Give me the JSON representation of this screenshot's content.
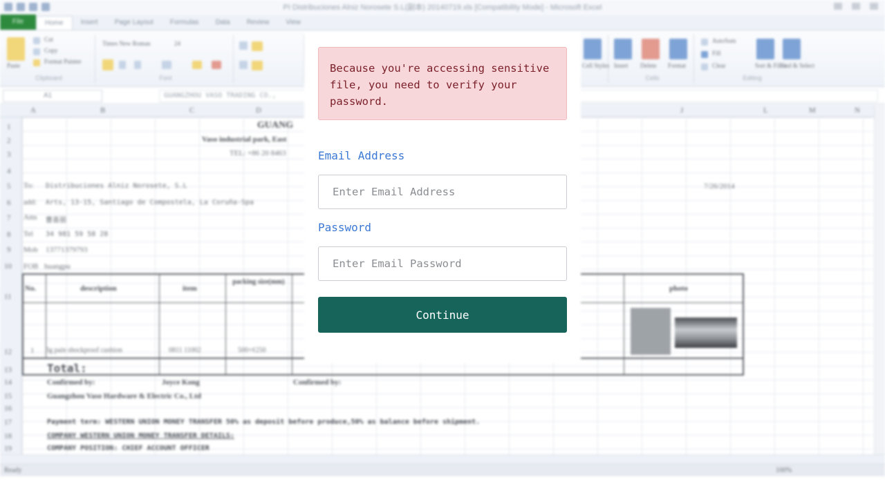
{
  "background": {
    "window_title": "PI Distribuciones Alniz Norosete S.L(副本) 20140719.xls [Compatibility Mode] - Microsoft Excel",
    "tabs": [
      "File",
      "Home",
      "Insert",
      "Page Layout",
      "Formulas",
      "Data",
      "Review",
      "View"
    ],
    "ribbon": {
      "clipboard": {
        "paste": "Paste",
        "cut": "Cut",
        "copy": "Copy",
        "format_painter": "Format Painter",
        "caption": "Clipboard"
      },
      "font": {
        "font_name": "Times New Roman",
        "font_size": "24",
        "caption": "Font"
      },
      "styles": {
        "cell_styles": "Cell Styles"
      },
      "cells": {
        "insert": "Insert",
        "delete": "Delete",
        "format": "Format",
        "caption": "Cells"
      },
      "editing": {
        "autosum": "AutoSum",
        "fill": "Fill",
        "clear": "Clear",
        "sort": "Sort & Filter",
        "find": "Find & Select",
        "caption": "Editing"
      }
    },
    "name_box": "A1",
    "formula": "GUANGZHOU VASO TRADING CO.,",
    "columns": [
      "A",
      "B",
      "C",
      "D",
      "J",
      "L",
      "M",
      "N"
    ],
    "rows": [
      "1",
      "2",
      "3",
      "4",
      "5",
      "6",
      "7",
      "8",
      "9",
      "10",
      "11",
      "12",
      "13",
      "14",
      "15",
      "16",
      "17",
      "18",
      "19"
    ],
    "sheet": {
      "company": "GUANG",
      "address": "Vaso industrial park, East",
      "tel": "TEL: +86 20 8463",
      "to_label": "To:",
      "to_value": "Distribuciones Alniz Norosete, S.L",
      "addr_label": "add:",
      "addr_value": "Arts, 13-15, Santiago de Compostela, La Coruña-Spa",
      "attn_label": "Attn",
      "attn_value": "曹喜丽",
      "tel_label": "Tel",
      "tel_value": "34 981 59 58 28",
      "mob_label": "Mob",
      "mob_value": "13771379793",
      "fob_label": "FOB",
      "fob_value": "huangpu",
      "date": "7/26/2014",
      "headers": {
        "no": "No.",
        "description": "description",
        "item": "item",
        "packing": "packing size(mm)",
        "photo": "photo"
      },
      "row1": {
        "no": "1",
        "description": "3g pain shockproof cushion",
        "item": "0811 11002",
        "packing": "500×¢250"
      },
      "total": "Total:",
      "confirmed1": "Confirmed by:",
      "confirmed_name": "Joyce Kong",
      "confirmed2": "Confirmed by:",
      "company_line": "Guangzhou Vaso Hardware & Electric Co., Ltd",
      "payment": "Payment term: WESTERN UNION MONEY TRANSFER 50% as deposit before produce,50% as balance before shipment.",
      "company_details": "COMPANY WESTERN UNION MONEY TRANSFER DETAILS:",
      "company_position": "COMPANY POSITION: CHIEF ACCOUNT OFFICER"
    },
    "status": {
      "ready": "Ready",
      "zoom": "100%"
    }
  },
  "dialog": {
    "alert_message": "Because you're accessing sensitive file, you need to verify your password.",
    "email_label": "Email Address",
    "email_placeholder": "Enter Email Address",
    "email_value": "",
    "password_label": "Password",
    "password_placeholder": "Enter Email Password",
    "password_value": "",
    "continue_label": "Continue"
  },
  "colors": {
    "alert_bg": "#f8d7da",
    "alert_text": "#7a1f29",
    "label_blue": "#3a78d4",
    "button_green": "#17645a",
    "excel_green": "#2e8b3e"
  }
}
